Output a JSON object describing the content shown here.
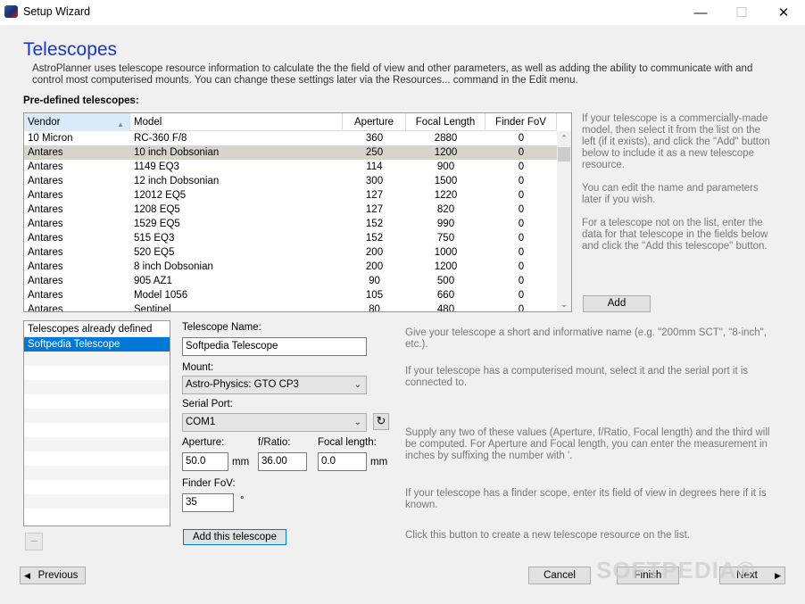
{
  "window": {
    "title": "Setup Wizard",
    "minimize_icon": "minimize-icon",
    "maximize_icon": "maximize-icon",
    "close_icon": "close-icon",
    "minimize_glyph": "—",
    "maximize_glyph": "☐",
    "close_glyph": "✕"
  },
  "page": {
    "title": "Telescopes",
    "intro": "AstroPlanner uses telescope resource information to calculate the the field of view and other parameters, as well as adding the ability to communicate with and control most computerised mounts. You can change these settings later via the Resources... command in the Edit menu.",
    "predefined_label": "Pre-defined telescopes:"
  },
  "table": {
    "columns": [
      "Vendor",
      "Model",
      "Aperture",
      "Focal Length",
      "Finder FoV"
    ],
    "sort_glyph": "▲",
    "rows": [
      [
        "10 Micron",
        "RC-360 F/8",
        "360",
        "2880",
        "0"
      ],
      [
        "Antares",
        "10 inch Dobsonian",
        "250",
        "1200",
        "0"
      ],
      [
        "Antares",
        "1149 EQ3",
        "114",
        "900",
        "0"
      ],
      [
        "Antares",
        "12 inch Dobsonian",
        "300",
        "1500",
        "0"
      ],
      [
        "Antares",
        "12012 EQ5",
        "127",
        "1220",
        "0"
      ],
      [
        "Antares",
        "1208 EQ5",
        "127",
        "820",
        "0"
      ],
      [
        "Antares",
        "1529 EQ5",
        "152",
        "990",
        "0"
      ],
      [
        "Antares",
        "515 EQ3",
        "152",
        "750",
        "0"
      ],
      [
        "Antares",
        "520 EQ5",
        "200",
        "1000",
        "0"
      ],
      [
        "Antares",
        "8 inch Dobsonian",
        "200",
        "1200",
        "0"
      ],
      [
        "Antares",
        "905 AZ1",
        "90",
        "500",
        "0"
      ],
      [
        "Antares",
        "Model 1056",
        "105",
        "660",
        "0"
      ],
      [
        "Antares",
        "Sentinel",
        "80",
        "480",
        "0"
      ]
    ],
    "selected_row": 1,
    "scroll_up_glyph": "⌃",
    "scroll_down_glyph": "⌄"
  },
  "help": {
    "predefined": "If your telescope is a commercially-made model, then select it from the list on the left (if it exists), and click the \"Add\" button below to include it as a new telescope resource.",
    "edit": "You can edit the name and parameters later if you wish.",
    "not_listed": "For a telescope not on the list, enter the data for that telescope in the fields below and click the \"Add this telescope\" button.",
    "name": "Give your telescope a short and informative name (e.g. \"200mm SCT\", \"8-inch\", etc.).",
    "mount": "If your telescope has a computerised mount, select it and the serial port it is connected to.",
    "values": "Supply any two of these values (Aperture, f/Ratio, Focal length) and the third will be computed. For Aperture and Focal length, you can enter the measurement in inches by suffixing the number with '.",
    "finder": "If your telescope has a finder scope, enter its field of view in degrees here if it is known.",
    "add_this": "Click this button to create a new telescope resource on the list."
  },
  "add_button": "Add",
  "defined": {
    "header": "Telescopes already defined",
    "items": [
      "Softpedia Telescope"
    ],
    "remove_glyph": "−"
  },
  "form": {
    "name_label": "Telescope Name:",
    "name_value": "Softpedia Telescope",
    "mount_label": "Mount:",
    "mount_value": "Astro-Physics: GTO CP3",
    "port_label": "Serial Port:",
    "port_value": "COM1",
    "refresh_glyph": "↻",
    "chevron_glyph": "⌄",
    "aperture_label": "Aperture:",
    "aperture_value": "50.0",
    "aperture_unit": "mm",
    "fratio_label": "f/Ratio:",
    "fratio_value": "36.00",
    "focal_label": "Focal length:",
    "focal_value": "0.0",
    "focal_unit": "mm",
    "fov_label": "Finder FoV:",
    "fov_value": "35",
    "fov_unit": "°",
    "add_this_button": "Add this telescope"
  },
  "nav": {
    "previous": "Previous",
    "cancel": "Cancel",
    "finish": "Finish",
    "next": "Next",
    "left_arrow": "◀",
    "right_arrow": "▶"
  },
  "watermark": "SOFTPEDIA®"
}
